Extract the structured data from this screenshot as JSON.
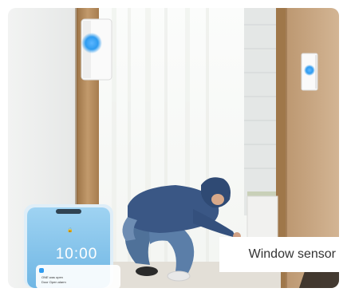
{
  "caption": {
    "text": "Window sensor"
  },
  "phone": {
    "time": "10:00",
    "notification_line1": "ONE was open",
    "notification_line2": "Door Open alarm"
  },
  "colors": {
    "sensor_led": "#2f9cf0",
    "door_frame": "#b48c5e",
    "jacket": "#3a5785",
    "jeans": "#5b7ea8",
    "phone_screen": "#7ec0e8"
  }
}
